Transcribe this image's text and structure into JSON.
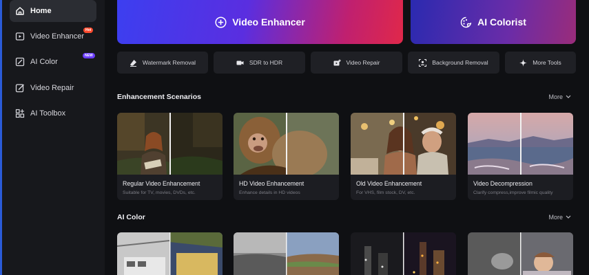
{
  "sidebar": {
    "items": [
      {
        "label": "Home",
        "icon": "home-icon"
      },
      {
        "label": "Video Enhancer",
        "icon": "video-icon",
        "badge": "Hot"
      },
      {
        "label": "AI Color",
        "icon": "color-icon",
        "badge": "NEW"
      },
      {
        "label": "Video Repair",
        "icon": "repair-icon"
      },
      {
        "label": "AI Toolbox",
        "icon": "toolbox-icon"
      }
    ]
  },
  "hero": {
    "video_enhancer": "Video Enhancer",
    "ai_colorist": "AI Colorist"
  },
  "tools": [
    {
      "label": "Watermark Removal",
      "icon": "eraser-icon"
    },
    {
      "label": "SDR to HDR",
      "icon": "camera-icon"
    },
    {
      "label": "Video Repair",
      "icon": "video-plus-icon"
    },
    {
      "label": "Background Removal",
      "icon": "portrait-icon"
    },
    {
      "label": "More Tools",
      "icon": "sparkle-icon"
    }
  ],
  "sections": {
    "enhancement": {
      "title": "Enhancement Scenarios",
      "more": "More",
      "cards": [
        {
          "title": "Regular Video Enhancement",
          "subtitle": "Suitable for TV, movies, DVDs, etc."
        },
        {
          "title": "HD Video Enhancement",
          "subtitle": "Enhance details in HD videos"
        },
        {
          "title": "Old Video Enhancement",
          "subtitle": "For VHS, film stock, DV, etc."
        },
        {
          "title": "Video Decompression",
          "subtitle": "Clarify compress,improve filmic quality"
        }
      ]
    },
    "ai_color": {
      "title": "AI Color",
      "more": "More"
    }
  },
  "colors": {
    "accent": "#2a5bd7",
    "hot_badge": "#ff4a2e",
    "new_badge": "#6a3cff"
  }
}
